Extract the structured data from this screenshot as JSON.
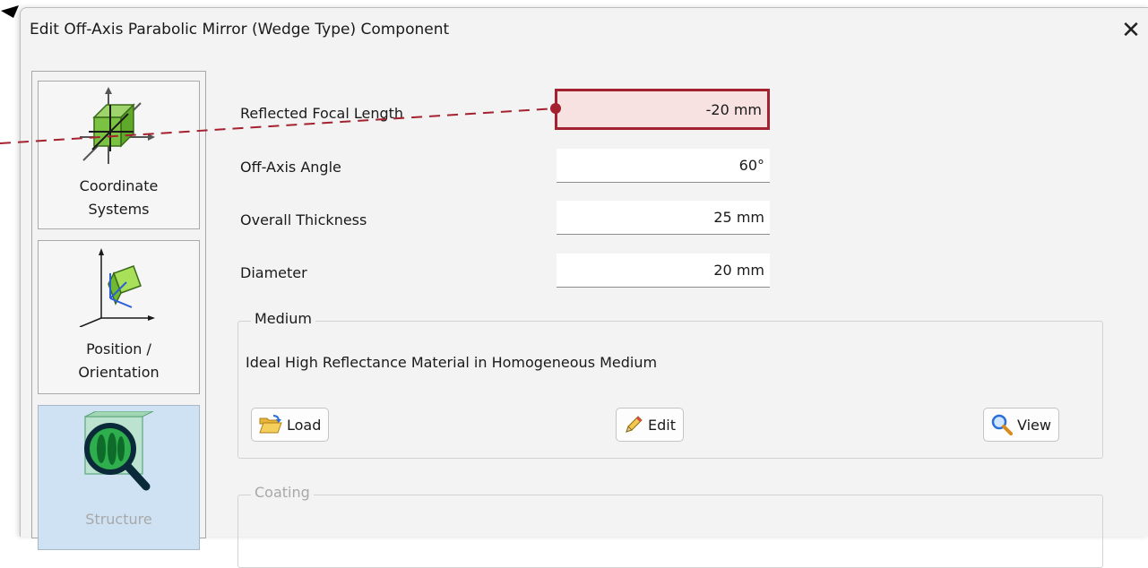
{
  "window": {
    "title": "Edit Off-Axis Parabolic Mirror (Wedge Type) Component",
    "close_glyph": "✕"
  },
  "sidebar": {
    "items": [
      {
        "label": "Coordinate\nSystems",
        "icon": "coordinate-systems-icon",
        "selected": false
      },
      {
        "label": "Position /\nOrientation",
        "icon": "position-orientation-icon",
        "selected": false
      },
      {
        "label": "Structure",
        "icon": "structure-icon",
        "selected": true
      }
    ]
  },
  "fields": {
    "focal_length": {
      "label": "Reflected Focal Length",
      "value": "-20 mm"
    },
    "off_axis_angle": {
      "label": "Off-Axis Angle",
      "value": "60°"
    },
    "thickness": {
      "label": "Overall Thickness",
      "value": "25 mm"
    },
    "diameter": {
      "label": "Diameter",
      "value": "20 mm"
    }
  },
  "medium": {
    "title": "Medium",
    "description": "Ideal High Reflectance Material in Homogeneous Medium",
    "load_label": "Load",
    "edit_label": "Edit",
    "view_label": "View"
  },
  "coating": {
    "title": "Coating"
  },
  "colors": {
    "highlight_border": "#a4212f",
    "highlight_fill": "#f8e1e1",
    "selected_nav": "#cfe2f3",
    "annotation_line": "#a4212f"
  }
}
